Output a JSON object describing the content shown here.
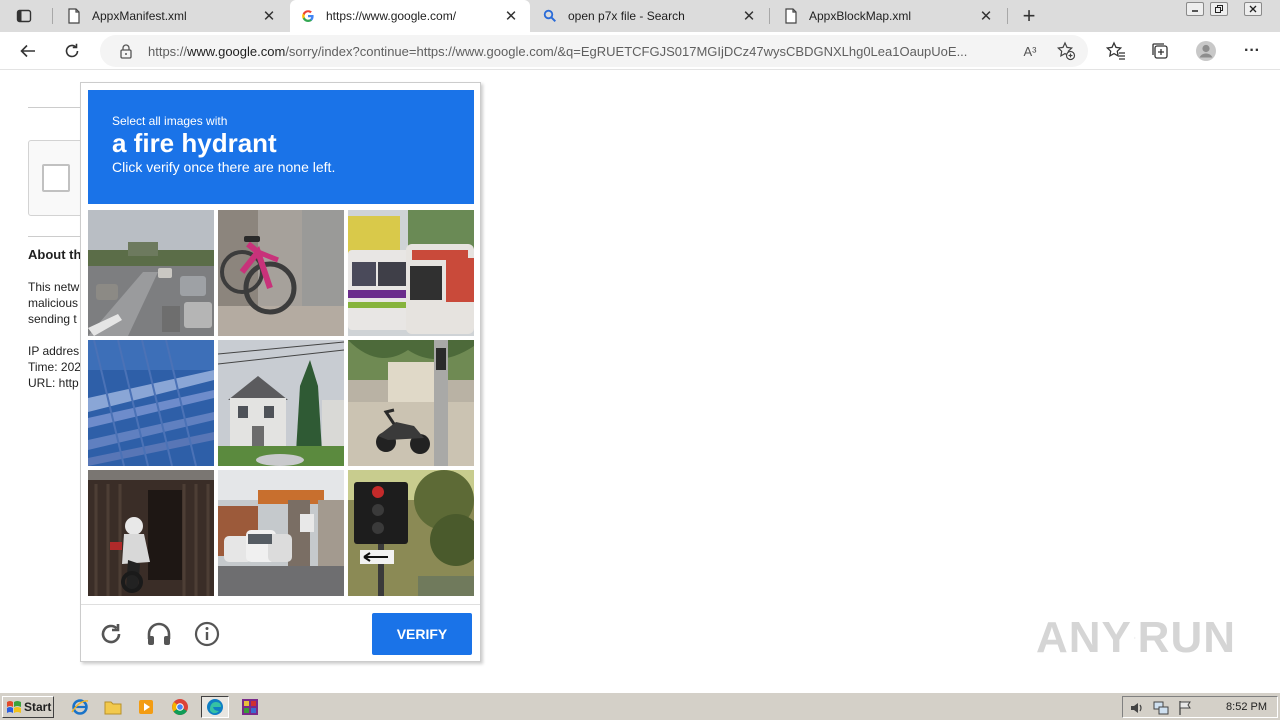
{
  "browser": {
    "tabs": [
      {
        "title": "AppxManifest.xml",
        "icon": "document-icon",
        "active": false
      },
      {
        "title": "https://www.google.com/",
        "icon": "google-icon",
        "active": true
      },
      {
        "title": "open p7x file - Search",
        "icon": "search-icon",
        "active": false
      },
      {
        "title": "AppxBlockMap.xml",
        "icon": "document-icon",
        "active": false
      }
    ],
    "close_glyph": "✕",
    "new_tab_glyph": "+",
    "url_prefix": "https://",
    "url_host": "www.google.com",
    "url_rest": "/sorry/index?continue=https://www.google.com/&q=EgRUETCFGJS017MGIjDCz47wysCBDGNXLhg0Lea1OaupUoE...",
    "read_aloud_glyph": "A³",
    "more_glyph": "···"
  },
  "page": {
    "about_title": "About th",
    "about_body": "This netw\nmalicious\nsending t",
    "about_meta": "IP addres\nTime: 202\nURL: http"
  },
  "challenge": {
    "line1": "Select all images with",
    "object": "a fire hydrant",
    "line3": "Click verify once there are none left.",
    "tiles": [
      "street-intersection",
      "pink-bicycle",
      "buses",
      "blue-roof",
      "white-house",
      "motorcycle-on-sidewalk",
      "motorcyclist-in-garage",
      "parked-cars",
      "traffic-light"
    ],
    "verify_label": "VERIFY",
    "accent_color": "#1a73e8"
  },
  "watermark": {
    "left": "ANY",
    "right": "RUN"
  },
  "taskbar": {
    "start_label": "Start",
    "clock": "8:52 PM"
  }
}
